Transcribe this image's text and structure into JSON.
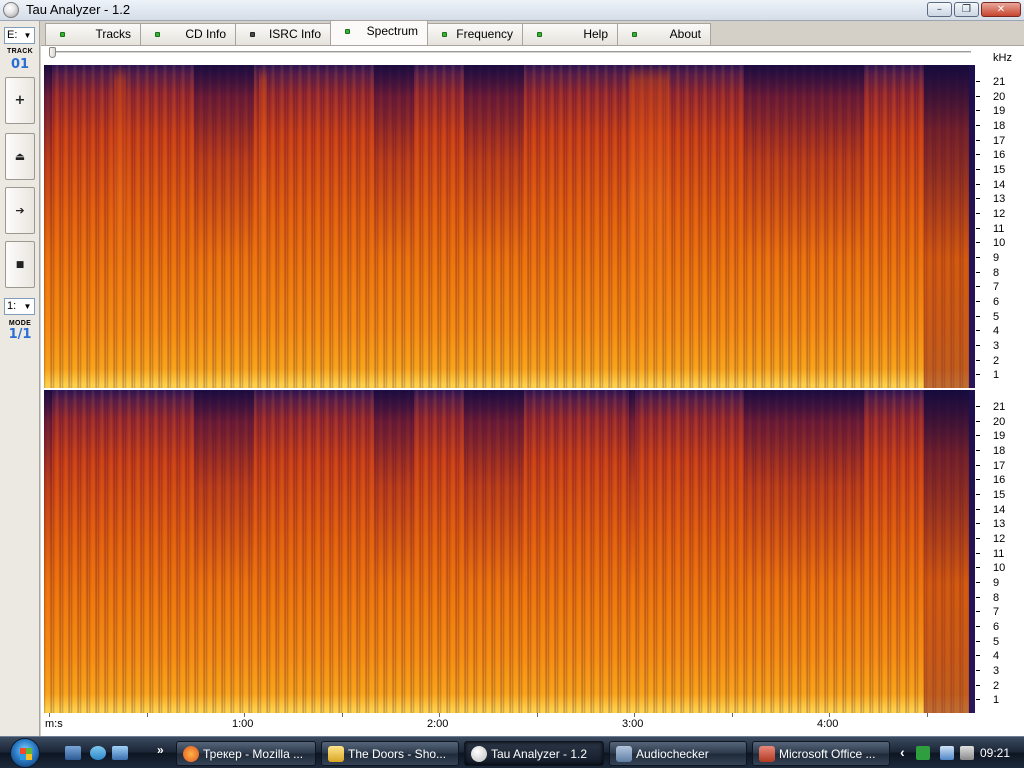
{
  "window": {
    "title": "Tau Analyzer - 1.2",
    "min_glyph": "–",
    "max_glyph": "❐",
    "close_glyph": "✕"
  },
  "leftbar": {
    "drive": "E:",
    "track_label": "TRACK",
    "track_value": "01",
    "buttons": [
      {
        "name": "add-button",
        "glyph": "+"
      },
      {
        "name": "eject-button",
        "glyph": "⏏"
      },
      {
        "name": "play-button",
        "glyph": "➔"
      },
      {
        "name": "stop-button",
        "glyph": "■"
      }
    ],
    "mode_select": "1:",
    "mode_label": "MODE",
    "mode_value": "1/1"
  },
  "tabs": [
    {
      "label": "Tracks",
      "active": false,
      "led": "green"
    },
    {
      "label": "CD Info",
      "active": false,
      "led": "green"
    },
    {
      "label": "ISRC Info",
      "active": false,
      "led": "dark"
    },
    {
      "label": "Spectrum",
      "active": true,
      "led": "green"
    },
    {
      "label": "Frequency",
      "active": false,
      "led": "green"
    },
    {
      "label": "Help",
      "active": false,
      "led": "green"
    },
    {
      "label": "About",
      "active": false,
      "led": "green"
    }
  ],
  "spectrum": {
    "unit_label": "kHz",
    "freq_ticks": [
      "21",
      "20",
      "19",
      "18",
      "17",
      "16",
      "15",
      "14",
      "13",
      "12",
      "11",
      "10",
      "9",
      "8",
      "7",
      "6",
      "5",
      "4",
      "3",
      "2",
      "1"
    ],
    "time_axis_label": "m:s",
    "time_labels": [
      "1:00",
      "2:00",
      "3:00",
      "4:00"
    ]
  },
  "taskbar": {
    "overflow_chevron": "»",
    "tasks": [
      {
        "label": "Трекер - Mozilla ...",
        "active": false
      },
      {
        "label": "The Doors - Sho...",
        "active": false
      },
      {
        "label": "Tau Analyzer - 1.2",
        "active": true
      },
      {
        "label": "Audiochecker",
        "active": false
      },
      {
        "label": "Microsoft Office ...",
        "active": false
      }
    ],
    "tray_chevron": "‹",
    "clock": "09:21"
  },
  "colors": {
    "spectrum_low": "#ffd24a",
    "spectrum_mid": "#e15c0b",
    "spectrum_high": "#2c1553",
    "led_green": "#31b531",
    "track_value_blue": "#2a6fd6"
  }
}
